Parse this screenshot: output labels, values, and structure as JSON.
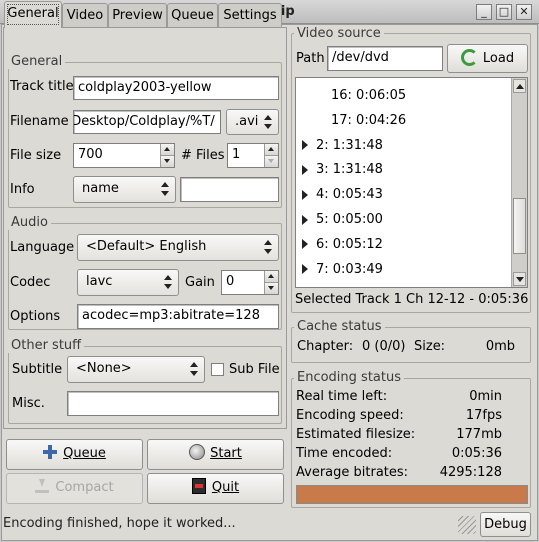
{
  "window": {
    "title": "acidrip"
  },
  "titlebar_buttons": [
    "_",
    "□",
    "✕"
  ],
  "tabs": [
    "General",
    "Video",
    "Preview",
    "Queue",
    "Settings"
  ],
  "general": {
    "section_general": "General",
    "track_title_label": "Track title",
    "track_title_value": "coldplay2003-yellow",
    "filename_label": "Filename",
    "filename_value": " /Desktop/Coldplay/%T",
    "filename_ext": ".avi",
    "filesize_label": "File size",
    "filesize_value": "700",
    "files_label": "# Files",
    "files_value": "1",
    "info_label": "Info",
    "info_value": "name",
    "info_text": "",
    "section_audio": "Audio",
    "language_label": "Language",
    "language_value": "<Default> English",
    "codec_label": "Codec",
    "codec_value": "lavc",
    "gain_label": "Gain",
    "gain_value": "0",
    "options_label": "Options",
    "options_value": "acodec=mp3:abitrate=128",
    "section_other": "Other stuff",
    "subtitle_label": "Subtitle",
    "subtitle_value": "<None>",
    "subfile_label": "Sub File",
    "misc_label": "Misc.",
    "misc_value": ""
  },
  "buttons": {
    "queue": "Queue",
    "start": "Start",
    "compact": "Compact",
    "quit": "Quit",
    "debug": "Debug",
    "load": "Load"
  },
  "video_source": {
    "title": "Video source",
    "path_label": "Path",
    "path_value": "/dev/dvd",
    "tracks": [
      {
        "label": "16: 0:06:05",
        "child": true
      },
      {
        "label": "17: 0:04:26",
        "child": true
      },
      {
        "label": "2: 1:31:48",
        "child": false
      },
      {
        "label": "3: 1:31:48",
        "child": false
      },
      {
        "label": "4: 0:05:43",
        "child": false
      },
      {
        "label": "5: 0:05:00",
        "child": false
      },
      {
        "label": "6: 0:05:12",
        "child": false
      },
      {
        "label": "7: 0:03:49",
        "child": false
      }
    ],
    "selected": "Selected Track 1 Ch 12-12 - 0:05:36"
  },
  "cache_status": {
    "title": "Cache status",
    "chapter_label": "Chapter:",
    "chapter_value": "0 (0/0)",
    "size_label": "Size:",
    "size_value": "0mb"
  },
  "encoding_status": {
    "title": "Encoding status",
    "rows": [
      {
        "label": "Real time left:",
        "value": "0min"
      },
      {
        "label": "Encoding speed:",
        "value": "17fps"
      },
      {
        "label": "Estimated filesize:",
        "value": "177mb"
      },
      {
        "label": "Time encoded:",
        "value": "0:05:36"
      },
      {
        "label": "Average bitrates:",
        "value": "4295:128"
      }
    ],
    "progress": 1.0,
    "progress_color": "#c87a4a"
  },
  "statusbar": {
    "text": "Encoding finished, hope it worked..."
  }
}
